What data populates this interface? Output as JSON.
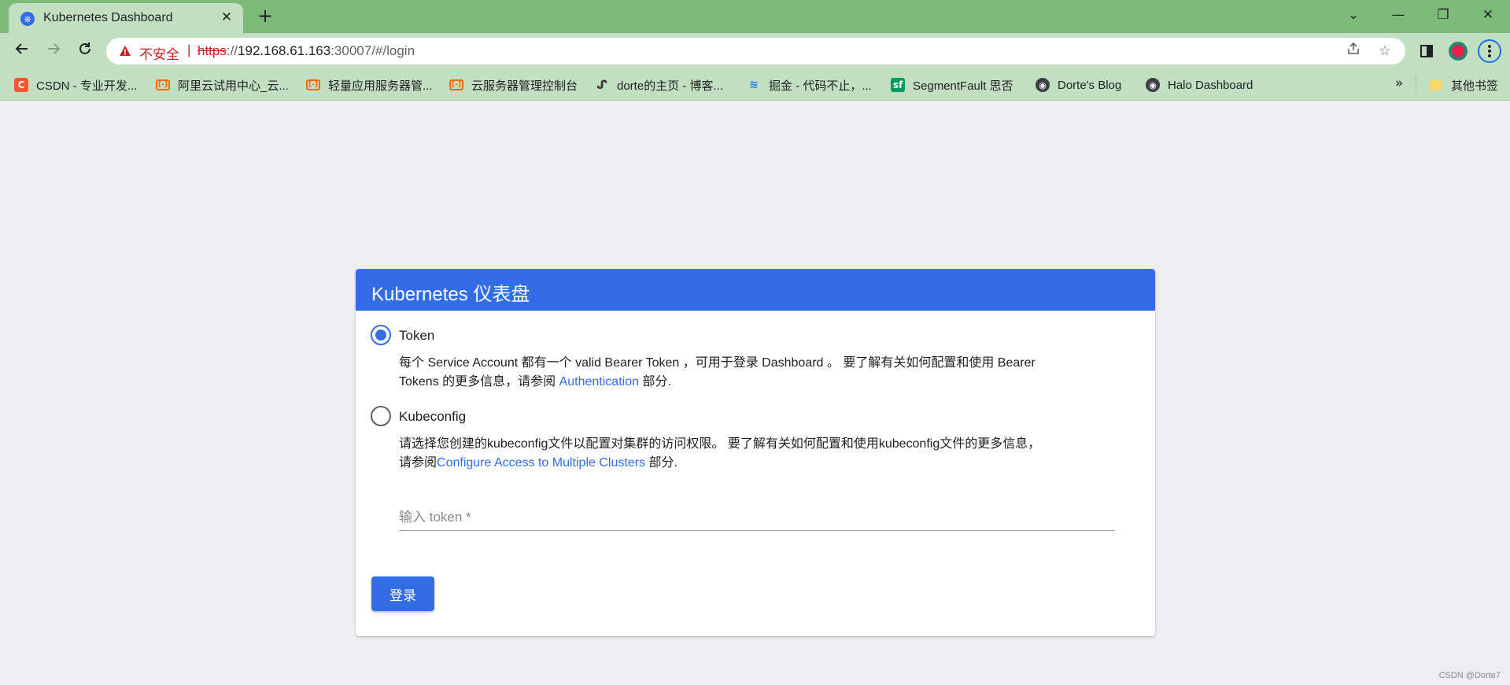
{
  "browser": {
    "tab": {
      "title": "Kubernetes Dashboard",
      "favicon": "kubernetes-icon",
      "close_glyph": "✕"
    },
    "new_tab_glyph": "+",
    "window_controls": {
      "chevron": "⌄",
      "minimize": "—",
      "restore": "❐",
      "close": "✕"
    },
    "address_bar": {
      "security_label": "不安全",
      "separator": "|",
      "url_scheme": "https",
      "url_scheme_sep": "://",
      "url_host": "192.168.61.163",
      "url_rest": ":30007/#/login"
    },
    "bookmarks": [
      {
        "label": "CSDN - 专业开发...",
        "icon": "csdn-icon",
        "glyph": "C"
      },
      {
        "label": "阿里云试用中心_云...",
        "icon": "aliyun-icon",
        "glyph": "[-]"
      },
      {
        "label": "轻量应用服务器管...",
        "icon": "aliyun-icon",
        "glyph": "[-]"
      },
      {
        "label": "云服务器管理控制台",
        "icon": "aliyun-icon",
        "glyph": "[-]"
      },
      {
        "label": "dorte的主页 - 博客...",
        "icon": "dorte-icon",
        "glyph": "ᔑ"
      },
      {
        "label": "掘金 - 代码不止，...",
        "icon": "juejin-icon",
        "glyph": "≋"
      },
      {
        "label": "SegmentFault 思否",
        "icon": "segmentfault-icon",
        "glyph": "sf"
      },
      {
        "label": "Dorte's Blog",
        "icon": "globe-icon",
        "glyph": "◉"
      },
      {
        "label": "Halo Dashboard",
        "icon": "globe-icon",
        "glyph": "◉"
      }
    ],
    "bookmarks_more": "»",
    "other_bookmarks": "其他书签"
  },
  "page": {
    "title": "Kubernetes 仪表盘",
    "options": [
      {
        "label": "Token",
        "selected": true,
        "desc_line1": "每个 Service Account 都有一个 valid Bearer Token ，可用于登录 Dashboard 。 要了解有关如何配置和使用 Bearer",
        "desc_prefix": "Tokens 的更多信息，请参阅 ",
        "desc_link": "Authentication",
        "desc_suffix": " 部分."
      },
      {
        "label": "Kubeconfig",
        "selected": false,
        "desc_line1": "请选择您创建的kubeconfig文件以配置对集群的访问权限。 要了解有关如何配置和使用kubeconfig文件的更多信息，",
        "desc_prefix": "请参阅",
        "desc_link": "Configure Access to Multiple Clusters",
        "desc_suffix": " 部分."
      }
    ],
    "token_input": {
      "placeholder": "输入 token *",
      "value": ""
    },
    "login_button": "登录"
  },
  "watermark": "CSDN @Dorte7",
  "colors": {
    "accent": "#326de6",
    "chrome_green": "#7dbb7b",
    "chrome_light": "#c2e0c1",
    "insecure_red": "#c5221f"
  }
}
